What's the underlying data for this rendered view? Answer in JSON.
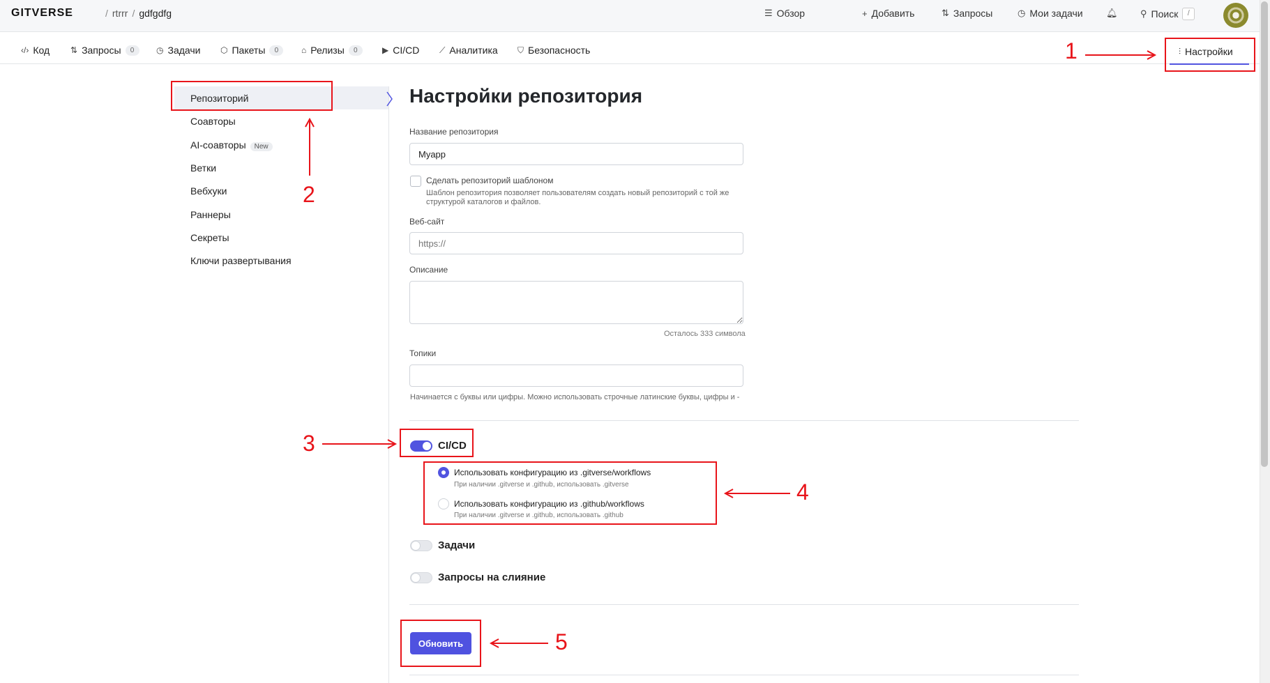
{
  "topbar": {
    "logo": "GITVERSE",
    "owner": "rtrrr",
    "repo": "gdfgdfg",
    "nav": [
      {
        "icon": "overview-icon",
        "label": "Обзор"
      },
      {
        "icon": "plus-icon",
        "label": "Добавить"
      },
      {
        "icon": "pull-request-icon",
        "label": "Запросы"
      },
      {
        "icon": "tasks-icon",
        "label": "Мои задачи"
      }
    ],
    "search_label": "Поиск",
    "search_shortcut": "/"
  },
  "tabs": [
    {
      "icon": "code-icon",
      "label": "Код"
    },
    {
      "icon": "pull-request-icon",
      "label": "Запросы",
      "count": "0"
    },
    {
      "icon": "tasks-icon",
      "label": "Задачи"
    },
    {
      "icon": "package-icon",
      "label": "Пакеты",
      "count": "0"
    },
    {
      "icon": "tag-icon",
      "label": "Релизы",
      "count": "0"
    },
    {
      "icon": "play-icon",
      "label": "CI/CD"
    },
    {
      "icon": "chart-icon",
      "label": "Аналитика"
    },
    {
      "icon": "shield-icon",
      "label": "Безопасность"
    },
    {
      "icon": "sliders-icon",
      "label": "Настройки"
    }
  ],
  "sidebar": {
    "items": [
      {
        "label": "Репозиторий"
      },
      {
        "label": "Соавторы"
      },
      {
        "label": "AI-соавторы",
        "badge": "New"
      },
      {
        "label": "Ветки"
      },
      {
        "label": "Вебхуки"
      },
      {
        "label": "Раннеры"
      },
      {
        "label": "Секреты"
      },
      {
        "label": "Ключи развертывания"
      }
    ]
  },
  "form": {
    "title": "Настройки репозитория",
    "name_label": "Название репозитория",
    "name_value": "Myapp",
    "template_label": "Сделать репозиторий шаблоном",
    "template_hint_1": "Шаблон репозитория позволяет пользователям создать новый репозиторий с той же",
    "template_hint_2": "структурой каталогов и файлов.",
    "website_label": "Веб-сайт",
    "website_placeholder": "https://",
    "description_label": "Описание",
    "description_counter": "Осталось 333 символа",
    "topics_label": "Топики",
    "topics_hint": "Начинается с буквы или цифры. Можно использовать строчные латинские буквы, цифры и -",
    "cicd_label": "CI/CD",
    "cicd_on": true,
    "radio_1_label": "Использовать конфигурацию из .gitverse/workflows",
    "radio_1_hint": "При наличии .gitverse и .github, использовать .gitverse",
    "radio_2_label": "Использовать конфигурацию из .github/workflows",
    "radio_2_hint": "При наличии .gitverse и .github, использовать .github",
    "issues_label": "Задачи",
    "issues_on": false,
    "pulls_label": "Запросы на слияние",
    "pulls_on": false,
    "submit_label": "Обновить"
  },
  "annotations": [
    "1",
    "2",
    "3",
    "4",
    "5"
  ],
  "colors": {
    "accent": "#5154e0",
    "annotation": "#e8141a"
  }
}
